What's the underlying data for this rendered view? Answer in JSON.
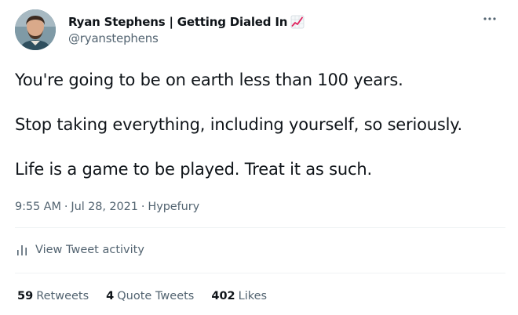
{
  "author": {
    "display_name": "Ryan Stephens | Getting Dialed In",
    "handle": "@ryanstephens",
    "name_emoji": "chart-increasing-icon"
  },
  "tweet": {
    "paragraphs": [
      "You're going to be on earth less than 100 years.",
      "Stop taking everything, including yourself, so seriously.",
      "Life is a game to be played. Treat it as such."
    ],
    "time": "9:55 AM",
    "date": "Jul 28, 2021",
    "source": "Hypefury",
    "separator": "·"
  },
  "activity": {
    "label": "View Tweet activity"
  },
  "stats": {
    "retweets_count": "59",
    "retweets_label": "Retweets",
    "quotes_count": "4",
    "quotes_label": "Quote Tweets",
    "likes_count": "402",
    "likes_label": "Likes"
  },
  "colors": {
    "text_primary": "#0f1419",
    "text_secondary": "#536471",
    "divider": "#eff3f4"
  }
}
